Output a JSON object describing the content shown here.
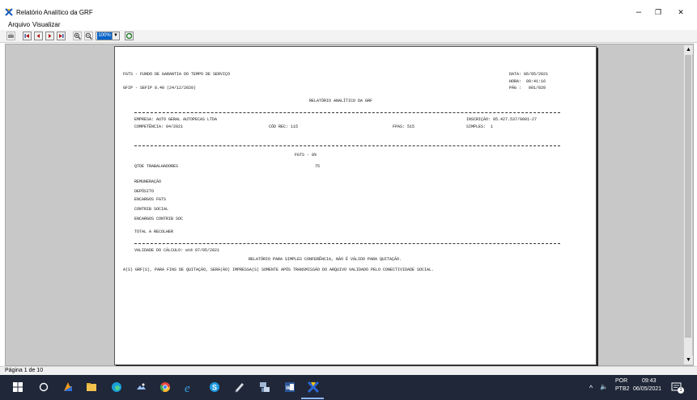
{
  "window": {
    "title": "Relatório Analítico da GRF",
    "minimize": "–",
    "maximize": "❐",
    "close": "✕"
  },
  "menu": [
    "Arquivo",
    "Visualizar"
  ],
  "toolbar": {
    "zoom_value": "100%",
    "buttons": [
      "print-icon",
      "first-page-icon",
      "previous-page-icon",
      "next-page-icon",
      "last-page-icon",
      "zoom-in-icon",
      "zoom-out-icon",
      "refresh-icon"
    ]
  },
  "report": {
    "header_left_1": "FGTS - FUNDO DE GARANTIA DO TEMPO DE SERVIÇO",
    "header_left_2": "GFIP - SEFIP 8.40 (24/12/2020)",
    "date": "DATA: 06/05/2021",
    "time": "HORA:  09:41:16",
    "page": "PÁG :   001/020",
    "title": "RELATÓRIO ANALÍTICO DA GRF",
    "empresa": "EMPRESA: AUTO GERAL AUTOPECAS LTDA",
    "inscricao": "INSCRIÇÃO: 05.427.537/0001-27",
    "competencia": "COMPETÊNCIA: 04/2021",
    "cod_rec": "CÓD REC: 115",
    "fpas": "FPAS: 515",
    "simples": "SIMPLES:  1",
    "fgts_section": "FGTS - 8%",
    "qtde_label": "QTDE TRABALHADORES",
    "qtde_value": "75",
    "remuneracao": "REMUNERAÇÃO",
    "deposito": "DEPÓSITO",
    "encargos_fgts": "ENCARGOS FGTS",
    "contrib_social": "CONTRIB SOCIAL",
    "encargos_contrib": "ENCARGOS CONTRIB SOC",
    "total": "TOTAL A RECOLHER",
    "validade": "VALIDADE DO CÁLCULO: até 07/05/2021",
    "note_1": "RELATÓRIO PARA SIMPLES CONFERÊNCIA, NÃO É VÁLIDO PARA QUITAÇÃO.",
    "note_2": "A(S) GRF(S), PARA FINS DE QUITAÇÃO, SERÁ(ÃO) IMPRESSA(S) SOMENTE APÓS TRANSMISSÃO DO ARQUIVO VALIDADO PELO CONECTIVIDADE SOCIAL."
  },
  "status": {
    "page_indicator": "Página 1 de 10"
  },
  "taskbar": {
    "apps": [
      "start-icon",
      "search-icon",
      "pinned-app-icon",
      "file-explorer-icon",
      "edge-icon",
      "photos-icon",
      "chrome-icon",
      "internet-explorer-icon",
      "skype-icon",
      "notes-icon",
      "network-icon",
      "word-icon",
      "sefip-icon"
    ],
    "lang_1": "POR",
    "lang_2": "PTB2",
    "time": "09:43",
    "date": "06/05/2021",
    "speaker": "🔈",
    "chevron": "^",
    "notifications": "1"
  },
  "colors": {
    "taskbar": "#1f2738",
    "selection": "#0a64c8",
    "active_app": "#f5c518"
  }
}
